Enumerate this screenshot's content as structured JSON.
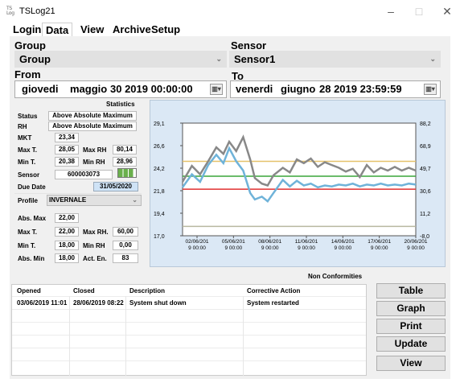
{
  "window": {
    "title": "TSLog21",
    "icon_text": "TS\nLog",
    "min": "–",
    "max": "□",
    "close": "✕"
  },
  "tabs": [
    "Login",
    "Data",
    "View",
    "Archive",
    "Setup"
  ],
  "group": {
    "label": "Group",
    "value": "Group"
  },
  "sensor": {
    "label": "Sensor",
    "value": "Sensor1"
  },
  "from": {
    "label": "From",
    "day": "giovedi",
    "month": "maggio",
    "datetime": "30 2019 00:00:00"
  },
  "to": {
    "label": "To",
    "day": "venerdi",
    "month": "giugno",
    "datetime": "28 2019 23:59:59"
  },
  "statistics": {
    "title": "Statistics",
    "status_label": "Status",
    "status_value": "Above Absolute Maximum",
    "rh_label": "RH",
    "rh_value": "Above Absolute Maximum",
    "mkt_label": "MKT",
    "mkt_value": "23,34",
    "maxt_label": "Max T.",
    "maxt_value": "28,05",
    "maxrh_label": "Max RH",
    "maxrh_value": "80,14",
    "mint_label": "Min T.",
    "mint_value": "20,38",
    "minrh_label": "Min RH",
    "minrh_value": "28,96",
    "sensor_label": "Sensor",
    "sensor_value": "600003073",
    "due_label": "Due Date",
    "due_value": "31/05/2020"
  },
  "profile": {
    "label": "Profile",
    "value": "INVERNALE",
    "absmax_label": "Abs. Max",
    "absmax_value": "22,00",
    "maxt_label": "Max T.",
    "maxt_value": "22,00",
    "maxrh_label": "Max RH.",
    "maxrh_value": "60,00",
    "mint_label": "Min T.",
    "mint_value": "18,00",
    "minrh_label": "Min RH",
    "minrh_value": "0,00",
    "absmin_label": "Abs. Min",
    "absmin_value": "18,00",
    "acten_label": "Act. En.",
    "acten_value": "83"
  },
  "chart_data": {
    "type": "line",
    "left_axis": {
      "ticks": [
        "29,1",
        "26,6",
        "24,2",
        "21,8",
        "19,4",
        "17,0"
      ],
      "min": 17.0,
      "max": 29.1
    },
    "right_axis": {
      "ticks": [
        "88,2",
        "68,9",
        "49,7",
        "30,6",
        "11,2",
        "-8,0"
      ],
      "min": -8.0,
      "max": 88.2
    },
    "x_ticks": [
      [
        "02/06/201",
        "9 00:00"
      ],
      [
        "05/06/201",
        "9 00:00"
      ],
      [
        "08/06/201",
        "9 00:00"
      ],
      [
        "11/06/201",
        "9 00:00"
      ],
      [
        "14/06/201",
        "9 00:00"
      ],
      [
        "17/06/201",
        "9 00:00"
      ],
      [
        "20/06/201",
        "9 00:00"
      ]
    ],
    "reference_lines": [
      {
        "value": 25.0,
        "color": "#e5c16a"
      },
      {
        "value": 23.4,
        "color": "#3aa63a"
      },
      {
        "value": 22.0,
        "color": "#e03030"
      },
      {
        "value": 18.0,
        "color": "#b8b8a0"
      }
    ],
    "series": [
      {
        "color": "#888888",
        "values": [
          [
            0,
            22.8
          ],
          [
            0.8,
            24.5
          ],
          [
            1.5,
            23.6
          ],
          [
            2.2,
            25.0
          ],
          [
            2.9,
            26.5
          ],
          [
            3.5,
            25.8
          ],
          [
            4.0,
            27.1
          ],
          [
            4.6,
            26.1
          ],
          [
            5.2,
            27.6
          ],
          [
            5.8,
            25.2
          ],
          [
            6.2,
            23.2
          ],
          [
            6.8,
            22.6
          ],
          [
            7.3,
            22.4
          ],
          [
            7.8,
            23.5
          ],
          [
            8.6,
            24.3
          ],
          [
            9.2,
            23.8
          ],
          [
            9.8,
            25.2
          ],
          [
            10.4,
            24.8
          ],
          [
            11.0,
            25.3
          ],
          [
            11.6,
            24.4
          ],
          [
            12.2,
            24.9
          ],
          [
            12.8,
            24.6
          ],
          [
            13.4,
            24.3
          ],
          [
            14.0,
            23.9
          ],
          [
            14.6,
            24.2
          ],
          [
            15.2,
            23.3
          ],
          [
            15.8,
            24.6
          ],
          [
            16.4,
            23.8
          ],
          [
            17.0,
            24.3
          ],
          [
            17.6,
            24.0
          ],
          [
            18.2,
            24.4
          ],
          [
            18.8,
            24.0
          ],
          [
            19.4,
            24.3
          ],
          [
            20.0,
            24.0
          ]
        ]
      },
      {
        "color": "#6fb3d9",
        "values": [
          [
            0,
            22.2
          ],
          [
            0.8,
            23.6
          ],
          [
            1.5,
            22.8
          ],
          [
            2.2,
            24.6
          ],
          [
            2.9,
            25.7
          ],
          [
            3.5,
            24.8
          ],
          [
            4.0,
            26.4
          ],
          [
            4.6,
            25.0
          ],
          [
            5.2,
            24.0
          ],
          [
            5.8,
            21.6
          ],
          [
            6.2,
            20.9
          ],
          [
            6.8,
            21.2
          ],
          [
            7.3,
            20.7
          ],
          [
            7.8,
            21.6
          ],
          [
            8.6,
            23.0
          ],
          [
            9.2,
            22.3
          ],
          [
            9.8,
            22.9
          ],
          [
            10.4,
            22.4
          ],
          [
            11.0,
            22.6
          ],
          [
            11.6,
            22.2
          ],
          [
            12.2,
            22.4
          ],
          [
            12.8,
            22.3
          ],
          [
            13.4,
            22.5
          ],
          [
            14.0,
            22.4
          ],
          [
            14.6,
            22.6
          ],
          [
            15.2,
            22.3
          ],
          [
            15.8,
            22.5
          ],
          [
            16.4,
            22.4
          ],
          [
            17.0,
            22.6
          ],
          [
            17.6,
            22.4
          ],
          [
            18.2,
            22.5
          ],
          [
            18.8,
            22.4
          ],
          [
            19.4,
            22.6
          ],
          [
            20.0,
            22.5
          ]
        ]
      }
    ]
  },
  "nonconf": {
    "title": "Non Conformities",
    "columns": [
      "Opened",
      "Closed",
      "Description",
      "Corrective Action"
    ],
    "rows": [
      [
        "03/06/2019 11:01",
        "28/06/2019 08:22",
        "System shut down",
        "System restarted"
      ]
    ]
  },
  "buttons": {
    "table": "Table",
    "graph": "Graph",
    "print": "Print",
    "update": "Update",
    "view": "View"
  }
}
